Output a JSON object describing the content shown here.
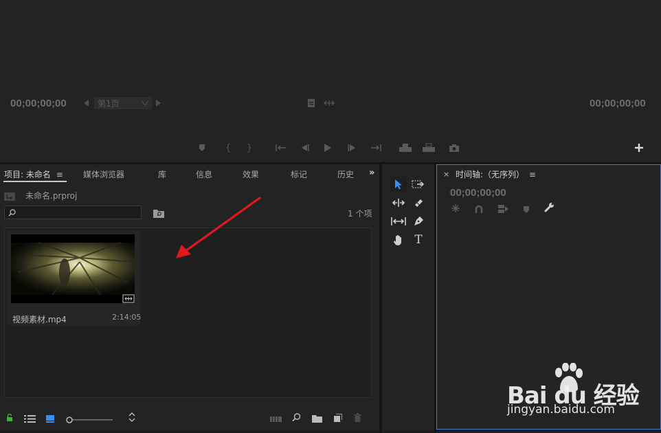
{
  "monitor": {
    "timecode_left": "00;00;00;00",
    "timecode_right": "00;00;00;00",
    "page_selector": "第1页",
    "add_icon": "plus-icon"
  },
  "project": {
    "tabs": [
      {
        "label": "项目: 未命名",
        "active": true
      },
      {
        "label": "媒体浏览器"
      },
      {
        "label": "库"
      },
      {
        "label": "信息"
      },
      {
        "label": "效果"
      },
      {
        "label": "标记"
      },
      {
        "label": "历史"
      }
    ],
    "project_file": "未命名.prproj",
    "item_count": "1 个项",
    "search_placeholder": "",
    "clip": {
      "name": "视频素材.mp4",
      "duration": "2:14:05"
    },
    "zoom_level": 0.0
  },
  "timeline": {
    "title": "时间轴:（无序列）",
    "timecode": "00;00;00;00"
  },
  "watermark": {
    "brand": "Bai du 经验",
    "url": "jingyan.baidu.com"
  },
  "colors": {
    "accent": "#3d7bd8",
    "tool_selected": "#3b8df0",
    "arrow": "#e0191c",
    "lock_green": "#3fae3f"
  }
}
